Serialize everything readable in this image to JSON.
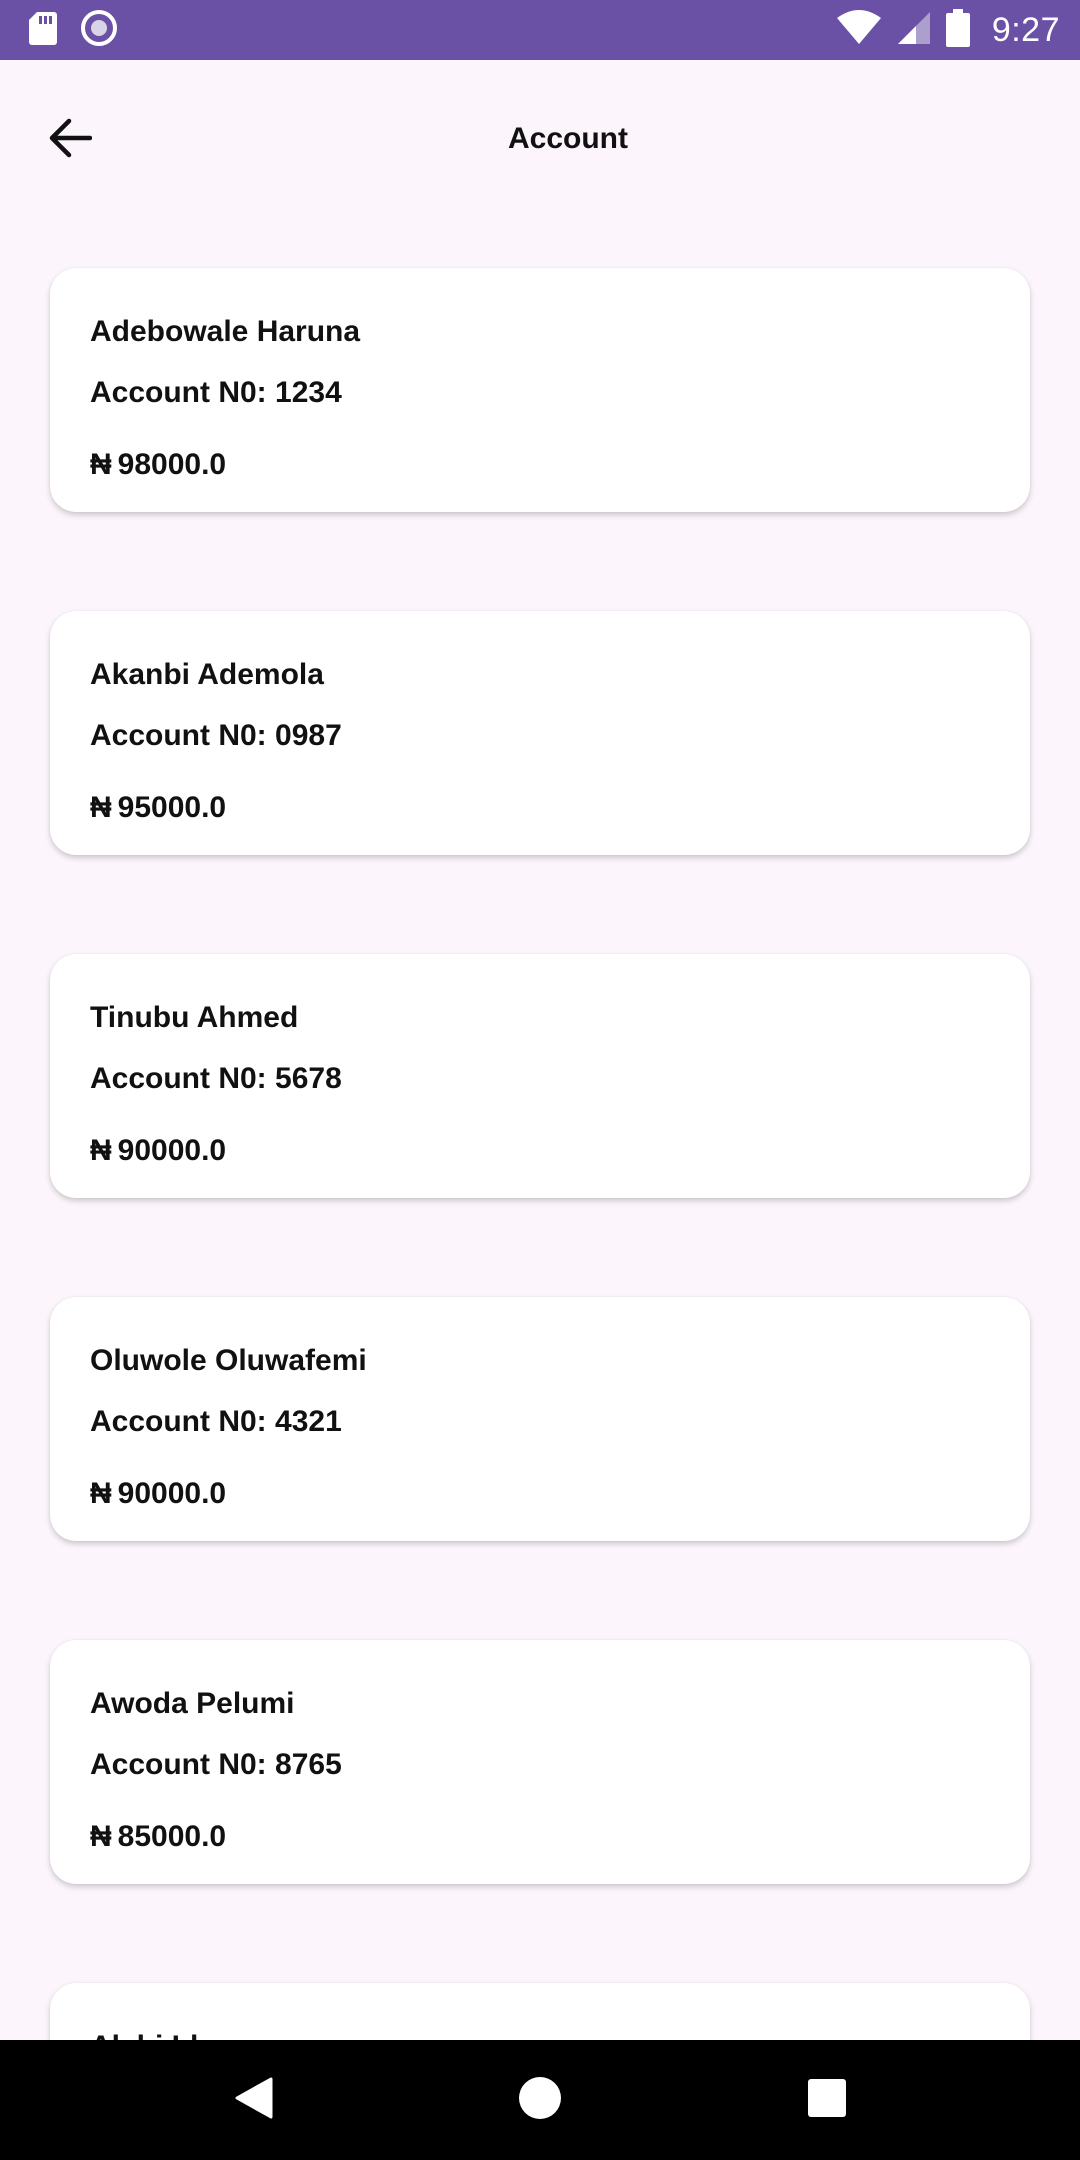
{
  "status_bar": {
    "time": "9:27",
    "left_icons": [
      "sd-card-icon",
      "radio-button-icon"
    ],
    "right_icons": [
      "wifi-icon",
      "signal-icon",
      "battery-icon"
    ],
    "background": "#6A51A5"
  },
  "app_bar": {
    "title": "Account",
    "back_icon": "arrow-left-icon"
  },
  "accounts": [
    {
      "name": "Adebowale Haruna",
      "account_no": "Account N0: 1234",
      "currency": "₦",
      "balance": "98000.0"
    },
    {
      "name": "Akanbi Ademola",
      "account_no": "Account N0: 0987",
      "currency": "₦",
      "balance": "95000.0"
    },
    {
      "name": "Tinubu Ahmed",
      "account_no": "Account N0: 5678",
      "currency": "₦",
      "balance": "90000.0"
    },
    {
      "name": "Oluwole Oluwafemi",
      "account_no": "Account N0: 4321",
      "currency": "₦",
      "balance": "90000.0"
    },
    {
      "name": "Awoda Pelumi",
      "account_no": "Account N0: 8765",
      "currency": "₦",
      "balance": "85000.0"
    },
    {
      "name": "Alabi Idera",
      "account_no": "",
      "currency": "",
      "balance": ""
    }
  ],
  "nav_bar": {
    "buttons": [
      "back-triangle-icon",
      "home-circle-icon",
      "recents-square-icon"
    ]
  },
  "colors": {
    "accent": "#6A51A5",
    "background": "#FCF5FC",
    "card": "#FFFFFF"
  }
}
